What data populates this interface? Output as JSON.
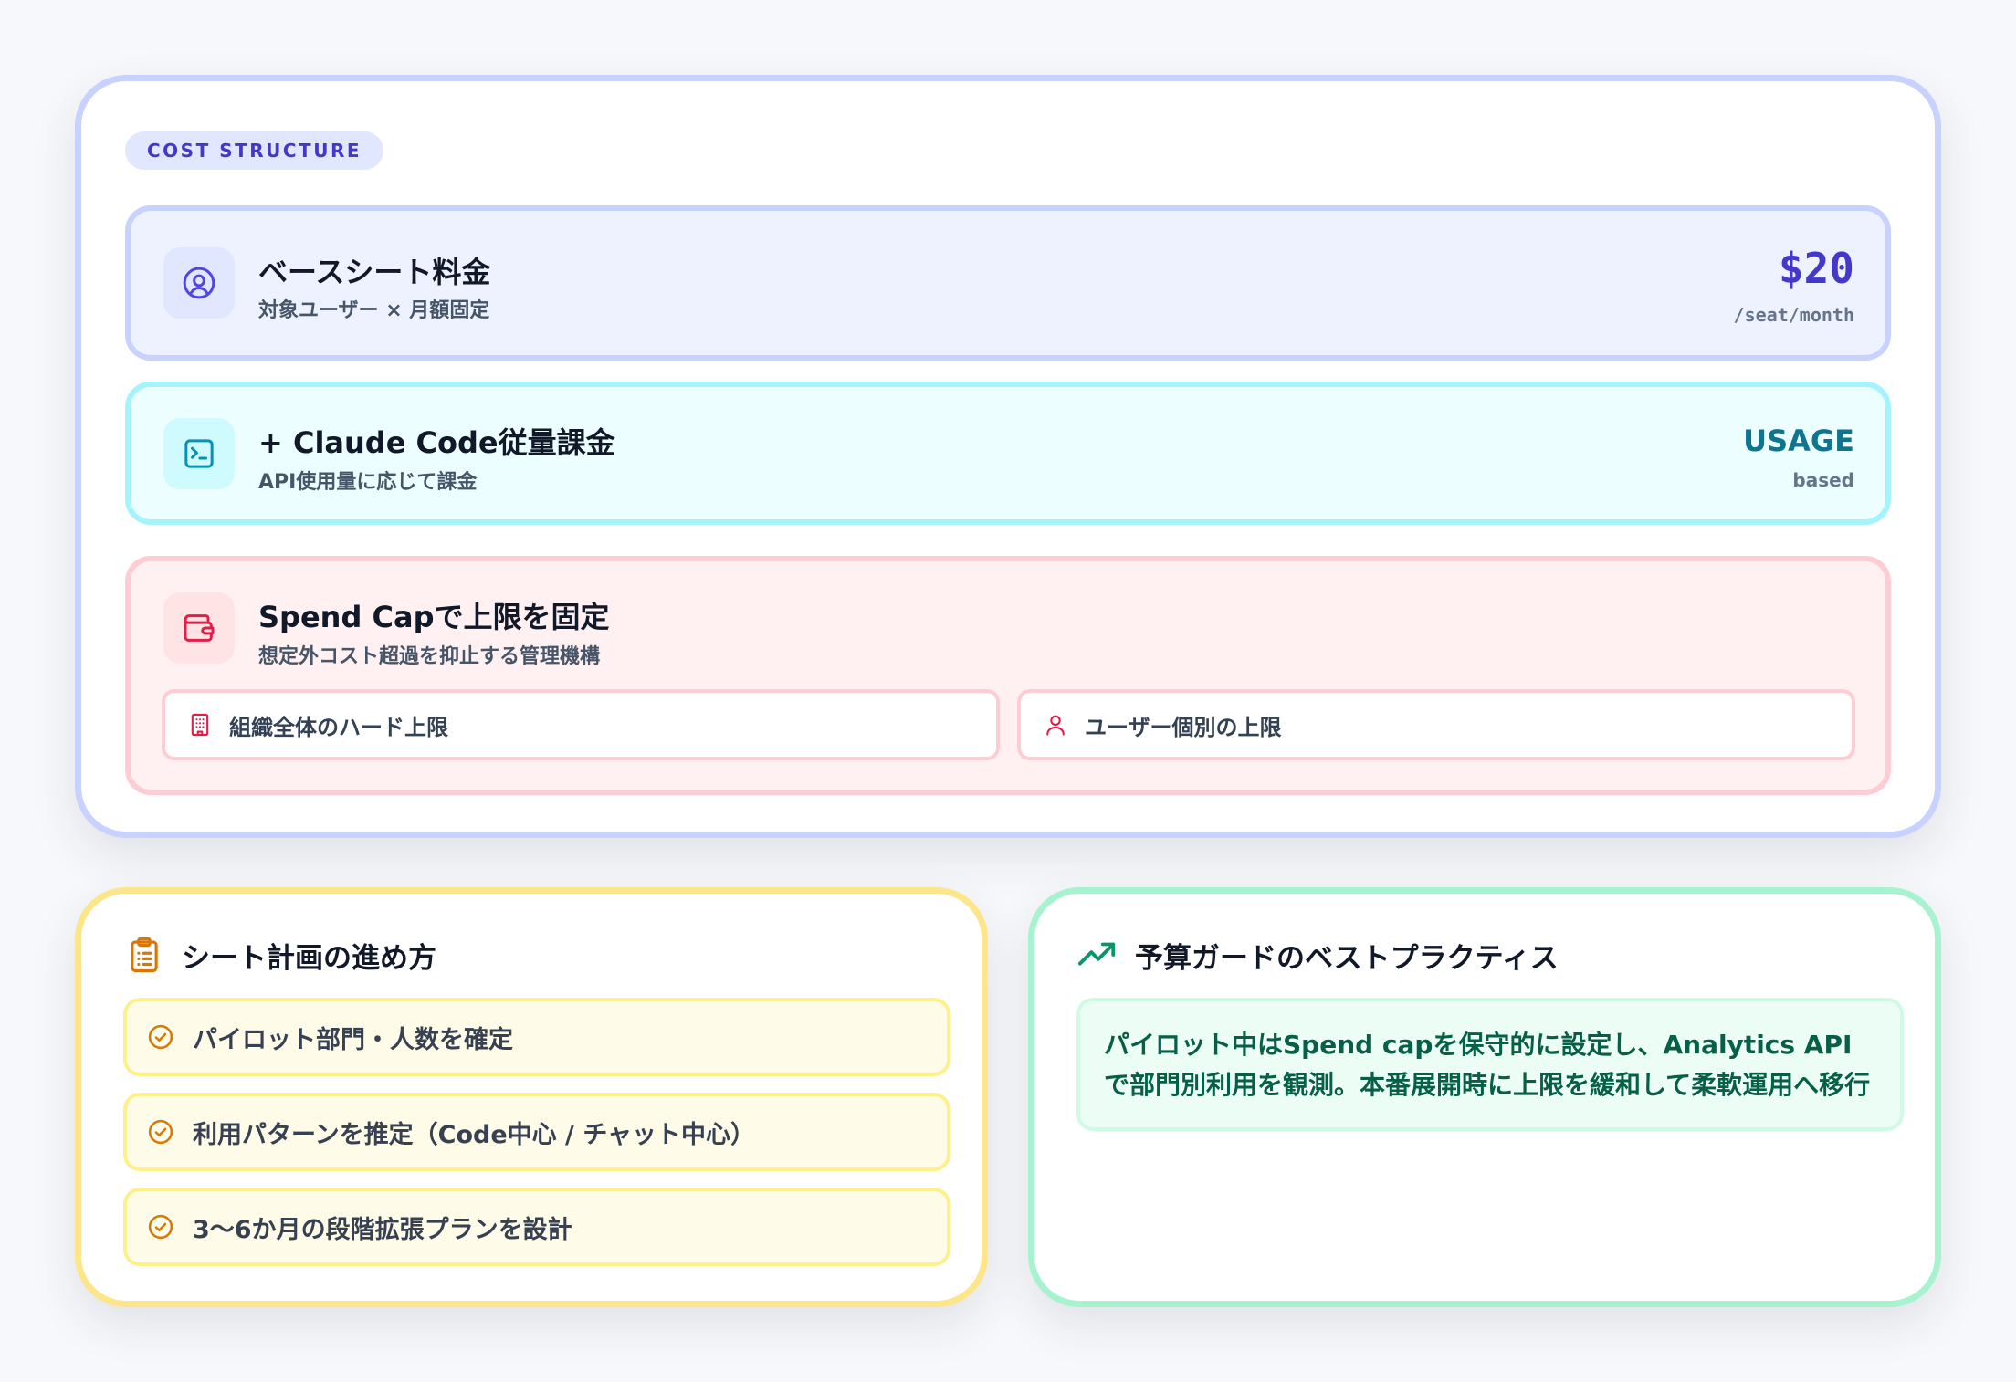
{
  "cost": {
    "pill_label": "COST STRUCTURE",
    "base": {
      "icon": "user-circle-icon",
      "title": "ベースシート料金",
      "subtitle": "対象ユーザー × 月額固定",
      "price": "$20",
      "price_unit": "/seat/month"
    },
    "usage": {
      "icon": "terminal-icon",
      "title": "+ Claude Code従量課金",
      "subtitle": "API使用量に応じて課金",
      "badge": "USAGE",
      "badge_sub": "based"
    },
    "cap": {
      "icon": "wallet-icon",
      "title": "Spend Capで上限を固定",
      "subtitle": "想定外コスト超過を抑止する管理機構",
      "options": [
        {
          "icon": "building-icon",
          "label": "組織全体のハード上限"
        },
        {
          "icon": "user-icon",
          "label": "ユーザー個別の上限"
        }
      ]
    }
  },
  "seat_plan": {
    "icon": "clipboard-list-icon",
    "title": "シート計画の進め方",
    "steps": [
      {
        "icon": "check-circle-icon",
        "label": "パイロット部門・人数を確定"
      },
      {
        "icon": "check-circle-icon",
        "label": "利用パターンを推定（Code中心 / チャット中心）"
      },
      {
        "icon": "check-circle-icon",
        "label": "3〜6か月の段階拡張プランを設計"
      }
    ]
  },
  "budget_guard": {
    "icon": "trending-up-icon",
    "title": "予算ガードのベストプラクティス",
    "text": "パイロット中はSpend capを保守的に設定し、Analytics APIで部門別利用を観測。本番展開時に上限を緩和して柔軟運用へ移行"
  },
  "colors": {
    "indigo": "#4338ca",
    "cyan": "#0e7490",
    "rose": "#e11d48",
    "amber": "#d97706",
    "emerald": "#059669"
  }
}
